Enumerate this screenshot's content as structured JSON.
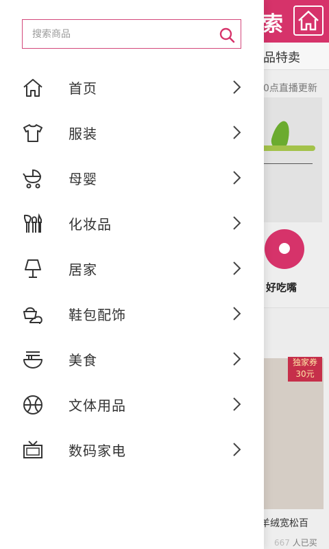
{
  "search": {
    "placeholder": "搜索商品"
  },
  "menu": {
    "items": [
      {
        "label": "首页",
        "icon": "home-icon"
      },
      {
        "label": "服装",
        "icon": "tshirt-icon"
      },
      {
        "label": "母婴",
        "icon": "stroller-icon"
      },
      {
        "label": "化妆品",
        "icon": "makeup-brush-icon"
      },
      {
        "label": "居家",
        "icon": "lamp-icon"
      },
      {
        "label": "鞋包配饰",
        "icon": "shoe-bag-icon"
      },
      {
        "label": "美食",
        "icon": "noodle-bowl-icon"
      },
      {
        "label": "文体用品",
        "icon": "ball-icon"
      },
      {
        "label": "数码家电",
        "icon": "tv-icon"
      }
    ]
  },
  "background": {
    "search_tail": "索",
    "subnav_text": "品特卖",
    "update_text": "0点直播更新",
    "category_label": "好吃嘴",
    "badge_line1": "独家券",
    "badge_line2": "30元",
    "product_title": "羊绒宽松百",
    "sold_count": "667",
    "sold_suffix": "人已买"
  },
  "colors": {
    "accent": "#d6336a",
    "border": "#d3467a",
    "text": "#333333"
  }
}
